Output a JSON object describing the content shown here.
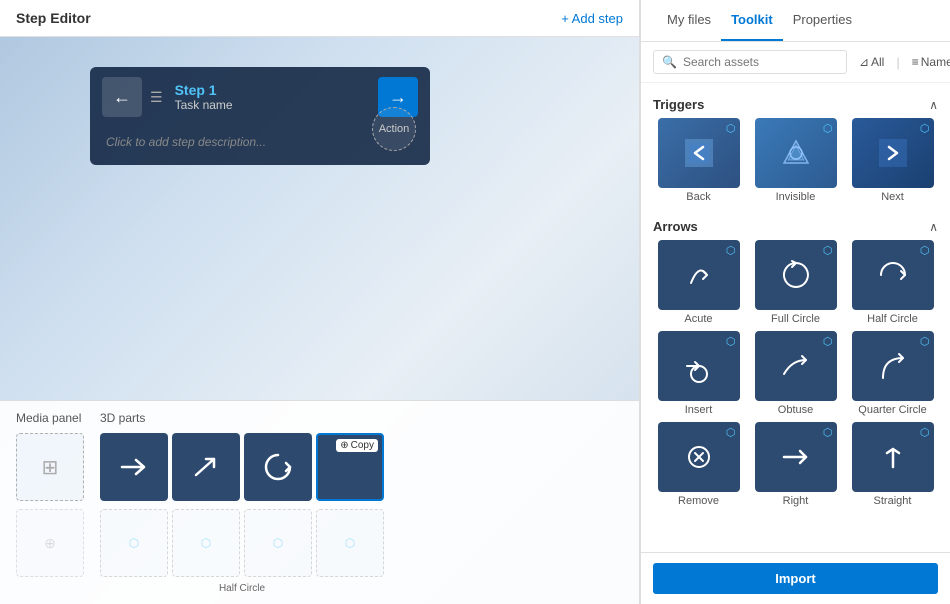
{
  "header": {
    "title": "Step Editor",
    "add_step_label": "+ Add step"
  },
  "step_card": {
    "step_name": "Step 1",
    "task_name": "Task name",
    "description": "Click to add step description...",
    "action_label": "Action",
    "back_arrow": "←",
    "next_arrow": "→"
  },
  "bottom_panels": {
    "media_label": "Media panel",
    "parts_label": "3D parts",
    "parts_items": [
      {
        "type": "right-arrow",
        "filled": true
      },
      {
        "type": "diagonal-arrow",
        "filled": true
      },
      {
        "type": "circle-arrow",
        "filled": true
      },
      {
        "type": "circle-arrow-copy",
        "filled": true,
        "copy": true
      }
    ],
    "empty_slots": 3
  },
  "right_panel": {
    "tabs": [
      "My files",
      "Toolkit",
      "Properties"
    ],
    "active_tab": "Toolkit",
    "search_placeholder": "Search assets",
    "filter_label": "All",
    "sort_label": "Name"
  },
  "triggers": {
    "title": "Triggers",
    "items": [
      {
        "label": "Back"
      },
      {
        "label": "Invisible"
      },
      {
        "label": "Next"
      }
    ]
  },
  "arrows": {
    "title": "Arrows",
    "items": [
      {
        "label": "Acute"
      },
      {
        "label": "Full Circle"
      },
      {
        "label": "Half Circle"
      },
      {
        "label": "Insert"
      },
      {
        "label": "Obtuse"
      },
      {
        "label": "Quarter Circle"
      },
      {
        "label": "Remove"
      },
      {
        "label": "Right"
      },
      {
        "label": "Straight"
      }
    ]
  },
  "import_label": "Import"
}
